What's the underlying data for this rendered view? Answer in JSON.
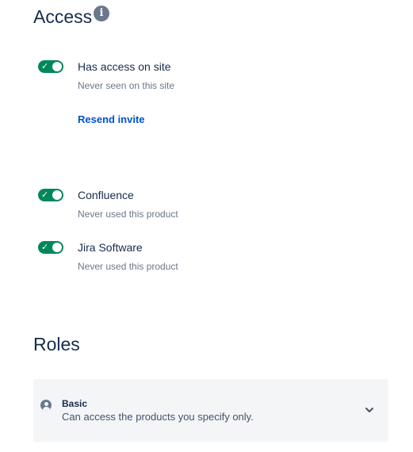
{
  "access": {
    "title": "Access",
    "info_icon": "info-icon",
    "info_glyph": "i",
    "site_access": {
      "label": "Has access on site",
      "sub": "Never seen on this site",
      "enabled": true,
      "link": "Resend invite"
    },
    "products": [
      {
        "label": "Confluence",
        "sub": "Never used this product",
        "enabled": true
      },
      {
        "label": "Jira Software",
        "sub": "Never used this product",
        "enabled": true
      }
    ]
  },
  "roles": {
    "title": "Roles",
    "selected": {
      "name": "Basic",
      "description": "Can access the products you specify only.",
      "icon": "user-icon"
    }
  },
  "colors": {
    "toggle_on": "#00875a",
    "link": "#0052cc",
    "heading": "#172b4d",
    "subtle": "#6b778c",
    "panel_bg": "#f4f5f7"
  }
}
